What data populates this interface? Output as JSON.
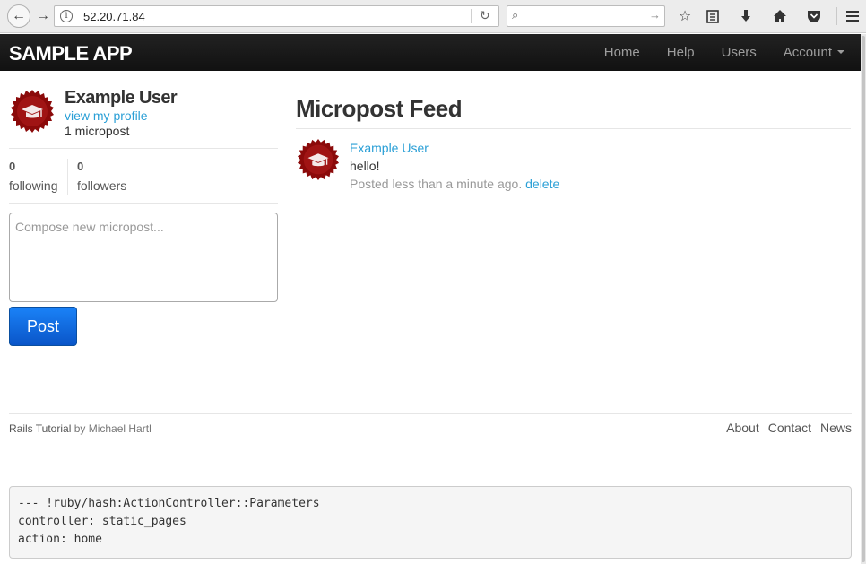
{
  "browser": {
    "url": "52.20.71.84",
    "search_placeholder": ""
  },
  "navbar": {
    "brand": "SAMPLE APP",
    "links": [
      "Home",
      "Help",
      "Users",
      "Account"
    ]
  },
  "sidebar": {
    "user_name": "Example User",
    "profile_link": "view my profile",
    "micropost_count": "1 micropost",
    "following_count": "0",
    "following_label": "following",
    "followers_count": "0",
    "followers_label": "followers",
    "compose_placeholder": "Compose new micropost...",
    "post_button": "Post"
  },
  "feed": {
    "title": "Micropost Feed",
    "items": [
      {
        "user": "Example User",
        "content": "hello!",
        "timestamp": "Posted less than a minute ago.",
        "delete_label": "delete"
      }
    ]
  },
  "footer": {
    "tutorial": "Rails Tutorial",
    "by": "by Michael Hartl",
    "links": [
      "About",
      "Contact",
      "News"
    ]
  },
  "debug": {
    "lines": [
      "--- !ruby/hash:ActionController::Parameters",
      "controller: static_pages",
      "action: home"
    ]
  },
  "colors": {
    "link": "#2a9fd6",
    "navbar": "#1b1b1b",
    "avatar": "#8b0a0a",
    "post_button": "#1a6fe0"
  }
}
